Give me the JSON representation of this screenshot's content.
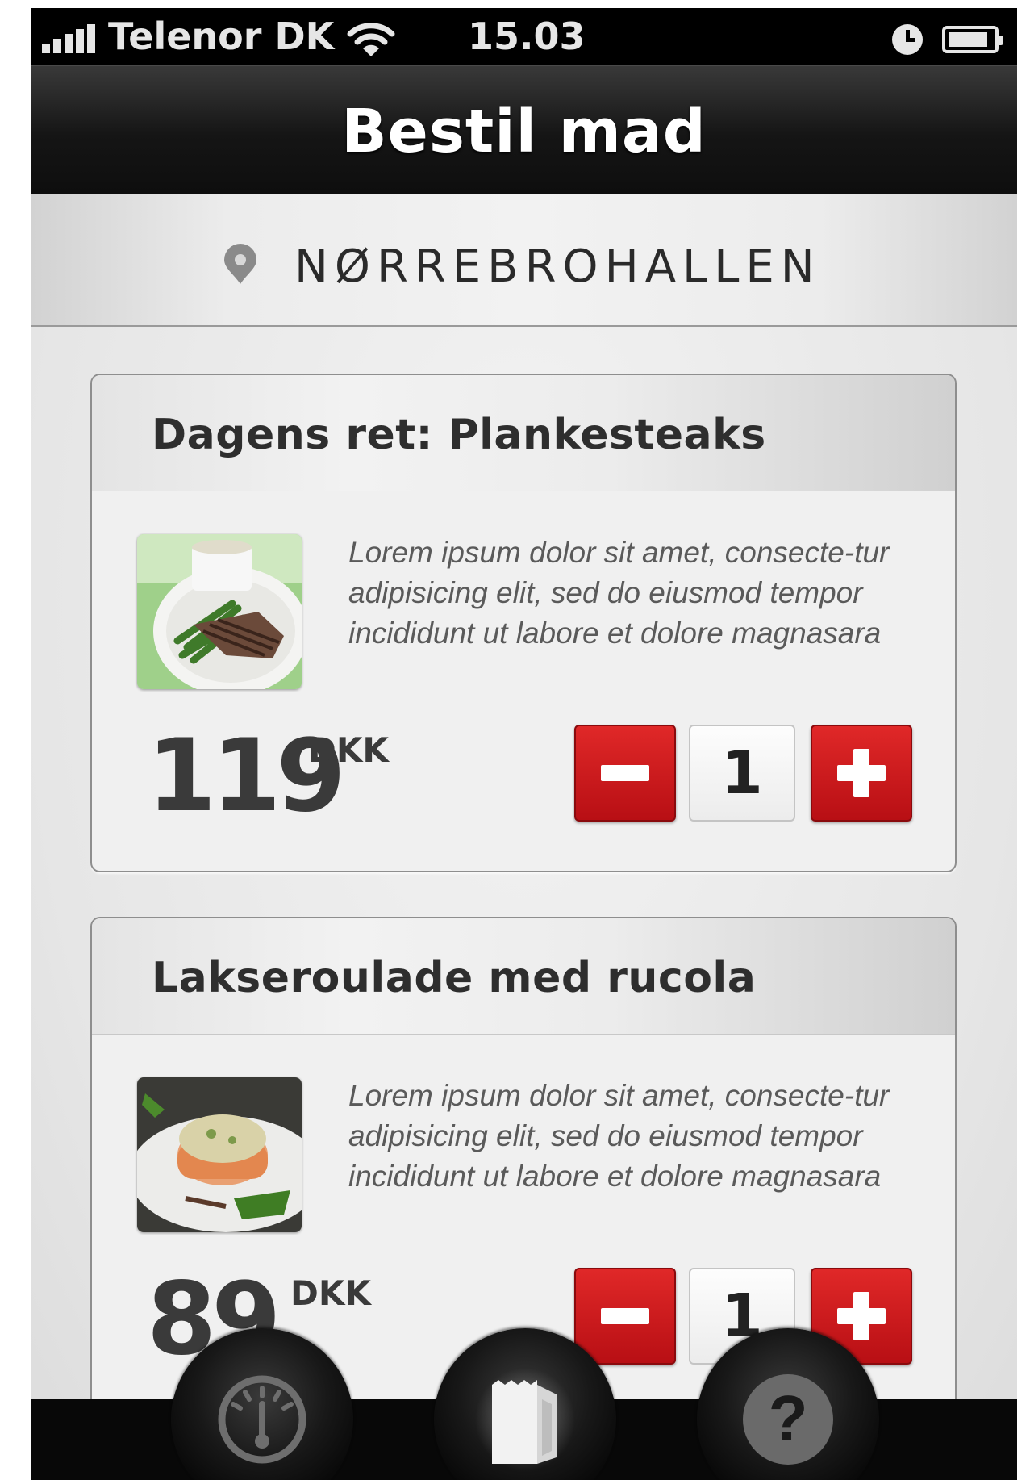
{
  "status_bar": {
    "carrier": "Telenor DK",
    "time": "15.03",
    "icons": [
      "signal-icon",
      "wifi-icon",
      "alarm-clock-icon",
      "battery-icon"
    ]
  },
  "nav": {
    "title": "Bestil mad"
  },
  "location": {
    "name": "NØRREBROHALLEN",
    "icon": "location-pin-icon"
  },
  "items": [
    {
      "title": "Dagens ret: Plankesteaks",
      "description": "Lorem ipsum dolor sit amet, consecte-tur adipisicing elit, sed do eiusmod tempor incididunt ut labore et dolore magnasara",
      "price": "119",
      "currency": "DKK",
      "quantity": "1"
    },
    {
      "title": "Lakseroulade med rucola",
      "description": "Lorem ipsum dolor sit amet, consecte-tur adipisicing elit, sed do eiusmod tempor incididunt ut labore et dolore magnasara",
      "price": "89",
      "currency": "DKK",
      "quantity": "1"
    }
  ],
  "tab_bar": {
    "tabs": [
      {
        "icon": "gauge-icon",
        "active": false
      },
      {
        "icon": "shopping-bag-icon",
        "active": true
      },
      {
        "icon": "help-icon",
        "active": false
      }
    ],
    "help_glyph": "?"
  },
  "colors": {
    "accent_red": "#c8171c",
    "nav_dark": "#151515",
    "text_dark": "#2e2e2e"
  }
}
